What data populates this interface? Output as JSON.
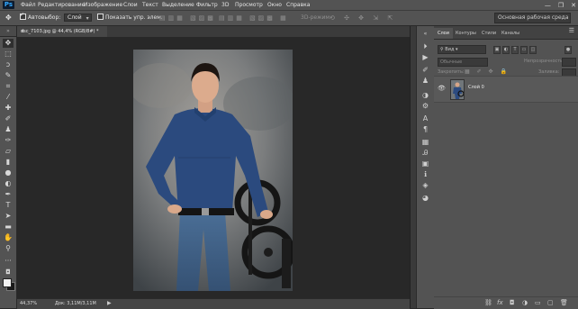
{
  "app": {
    "logo": "Ps"
  },
  "menu": [
    "Файл",
    "Редактирование",
    "Изображение",
    "Слои",
    "Текст",
    "Выделение",
    "Фильтр",
    "3D",
    "Просмотр",
    "Окно",
    "Справка"
  ],
  "window_controls": {
    "minimize": "—",
    "restore": "❐",
    "close": "✕"
  },
  "options": {
    "autoselect_label": "Автовыбор:",
    "autoselect_checked": true,
    "autoselect_value": "Слой",
    "show_controls_label": "Показать упр. элем.",
    "show_controls_checked": false,
    "mode_3d_label": "3D-режим:",
    "workspace": "Основная рабочая среда"
  },
  "document": {
    "tab_title": "dsc_7103.jpg @ 44,4% (RGB/8#) *",
    "close": "×",
    "zoom": "44,37%",
    "size_info": "Док: 3,11M/3,11M",
    "status_arrow": "▶"
  },
  "panel": {
    "tabs": [
      "Слои",
      "Контуры",
      "Стили",
      "Каналы"
    ],
    "active_tab": "Слои",
    "menu_icon": "☰",
    "filter_kind": "Вид",
    "blend_mode": "Обычные",
    "opacity_label": "Непрозрачность:",
    "lock_label": "Закрепить:",
    "fill_label": "Заливка:",
    "layer_name": "Слой 0",
    "layer_visible": true
  },
  "icons": {
    "tools": [
      "move-icon",
      "marquee-icon",
      "lasso-icon",
      "quick-select-icon",
      "crop-icon",
      "eyedropper-icon",
      "healing-brush-icon",
      "brush-icon",
      "clone-stamp-icon",
      "history-brush-icon",
      "eraser-icon",
      "gradient-icon",
      "blur-icon",
      "dodge-icon",
      "pen-icon",
      "type-icon",
      "path-select-icon",
      "rectangle-icon",
      "hand-icon",
      "zoom-icon",
      "more-tools-icon"
    ],
    "panel_strip": [
      "play-icon",
      "brush-preset-icon",
      "clone-source-icon",
      "adjust-icon",
      "properties-icon",
      "character-icon",
      "paragraph-icon",
      "swatches-icon",
      "glyph-icon",
      "styles-icon",
      "info-icon"
    ]
  },
  "colors": {
    "accent": "#31a8ff",
    "foreground": "#f2f2f2",
    "background": "#1a1a1a"
  }
}
